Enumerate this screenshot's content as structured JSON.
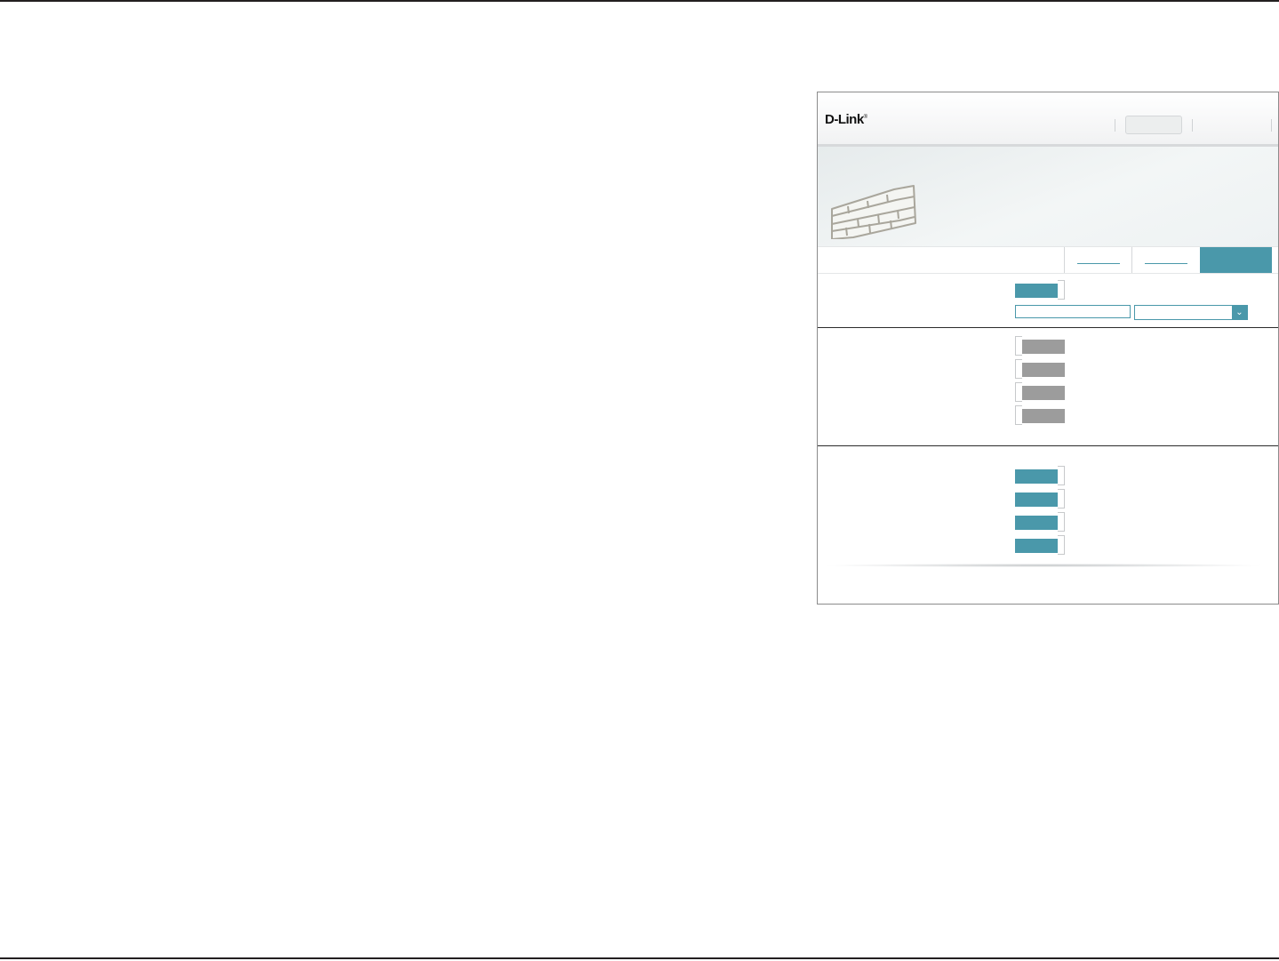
{
  "brand": {
    "logo_text": "D-Link",
    "logo_mark": "®"
  },
  "colors": {
    "accent": "#4a98aa",
    "toggle_off": "#9c9c9c",
    "frame_border": "#8c8c8c",
    "page_rule": "#231f20"
  },
  "icons": {
    "banner": "brick-wall-icon",
    "select_arrow": "chevron-down-icon"
  },
  "header": {
    "pill_label": "",
    "link_label": ""
  },
  "banner": {
    "title": ""
  },
  "tabs": [
    {
      "label": "",
      "active": false
    },
    {
      "label": "",
      "active": false
    },
    {
      "label": "",
      "active": true
    }
  ],
  "section1": {
    "toggle": {
      "label": "",
      "on": true
    },
    "address_input": {
      "value": "",
      "placeholder": ""
    },
    "schedule_select": {
      "value": ""
    }
  },
  "section2": {
    "toggles": [
      {
        "label": "",
        "on": false
      },
      {
        "label": "",
        "on": false
      },
      {
        "label": "",
        "on": false
      },
      {
        "label": "",
        "on": false
      }
    ]
  },
  "section3": {
    "toggles": [
      {
        "label": "",
        "on": true
      },
      {
        "label": "",
        "on": true
      },
      {
        "label": "",
        "on": true
      },
      {
        "label": "",
        "on": true
      }
    ]
  }
}
